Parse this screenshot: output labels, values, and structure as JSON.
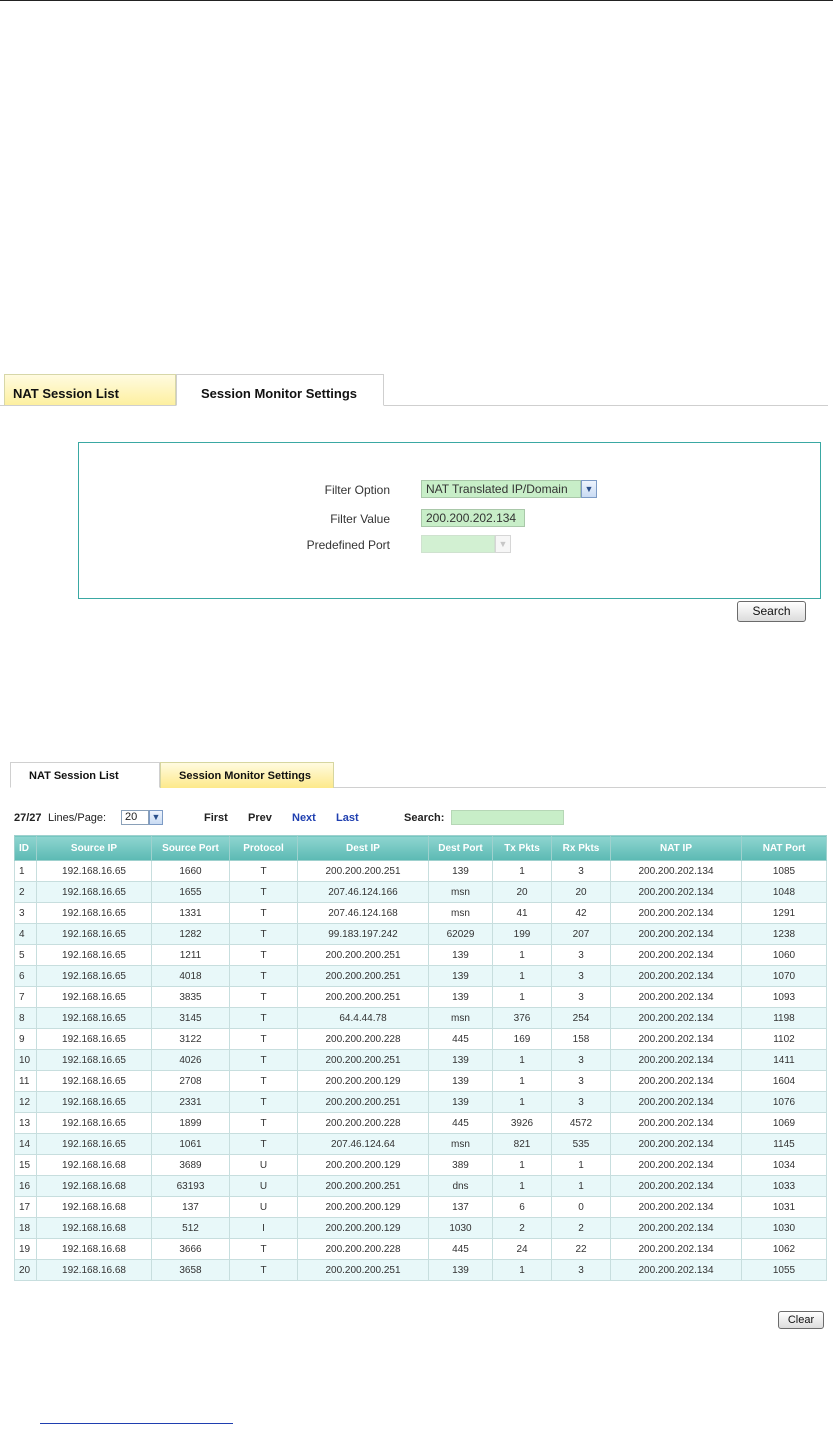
{
  "settings": {
    "tabs": [
      {
        "label": "NAT Session List",
        "active": false
      },
      {
        "label": "Session Monitor Settings",
        "active": true
      }
    ],
    "filter_option": {
      "label": "Filter Option",
      "value": "NAT Translated IP/Domain"
    },
    "filter_value": {
      "label": "Filter Value",
      "value": "200.200.202.134"
    },
    "predefined_port": {
      "label": "Predefined Port",
      "value": ""
    },
    "search_label": "Search"
  },
  "session_list": {
    "tabs": [
      {
        "label": "NAT Session List",
        "active": true
      },
      {
        "label": "Session Monitor Settings",
        "active": false
      }
    ],
    "count": "27/27",
    "lines_per_page_label": "Lines/Page:",
    "lines_per_page_value": "20",
    "first_label": "First",
    "prev_label": "Prev",
    "next_label": "Next",
    "last_label": "Last",
    "search_label": "Search:",
    "search_value": "",
    "clear_label": "Clear",
    "columns": [
      "ID",
      "Source IP",
      "Source Port",
      "Protocol",
      "Dest IP",
      "Dest Port",
      "Tx Pkts",
      "Rx Pkts",
      "NAT IP",
      "NAT Port"
    ],
    "rows": [
      [
        "1",
        "192.168.16.65",
        "1660",
        "T",
        "200.200.200.251",
        "139",
        "1",
        "3",
        "200.200.202.134",
        "1085"
      ],
      [
        "2",
        "192.168.16.65",
        "1655",
        "T",
        "207.46.124.166",
        "msn",
        "20",
        "20",
        "200.200.202.134",
        "1048"
      ],
      [
        "3",
        "192.168.16.65",
        "1331",
        "T",
        "207.46.124.168",
        "msn",
        "41",
        "42",
        "200.200.202.134",
        "1291"
      ],
      [
        "4",
        "192.168.16.65",
        "1282",
        "T",
        "99.183.197.242",
        "62029",
        "199",
        "207",
        "200.200.202.134",
        "1238"
      ],
      [
        "5",
        "192.168.16.65",
        "1211",
        "T",
        "200.200.200.251",
        "139",
        "1",
        "3",
        "200.200.202.134",
        "1060"
      ],
      [
        "6",
        "192.168.16.65",
        "4018",
        "T",
        "200.200.200.251",
        "139",
        "1",
        "3",
        "200.200.202.134",
        "1070"
      ],
      [
        "7",
        "192.168.16.65",
        "3835",
        "T",
        "200.200.200.251",
        "139",
        "1",
        "3",
        "200.200.202.134",
        "1093"
      ],
      [
        "8",
        "192.168.16.65",
        "3145",
        "T",
        "64.4.44.78",
        "msn",
        "376",
        "254",
        "200.200.202.134",
        "1198"
      ],
      [
        "9",
        "192.168.16.65",
        "3122",
        "T",
        "200.200.200.228",
        "445",
        "169",
        "158",
        "200.200.202.134",
        "1102"
      ],
      [
        "10",
        "192.168.16.65",
        "4026",
        "T",
        "200.200.200.251",
        "139",
        "1",
        "3",
        "200.200.202.134",
        "1411"
      ],
      [
        "11",
        "192.168.16.65",
        "2708",
        "T",
        "200.200.200.129",
        "139",
        "1",
        "3",
        "200.200.202.134",
        "1604"
      ],
      [
        "12",
        "192.168.16.65",
        "2331",
        "T",
        "200.200.200.251",
        "139",
        "1",
        "3",
        "200.200.202.134",
        "1076"
      ],
      [
        "13",
        "192.168.16.65",
        "1899",
        "T",
        "200.200.200.228",
        "445",
        "3926",
        "4572",
        "200.200.202.134",
        "1069"
      ],
      [
        "14",
        "192.168.16.65",
        "1061",
        "T",
        "207.46.124.64",
        "msn",
        "821",
        "535",
        "200.200.202.134",
        "1145"
      ],
      [
        "15",
        "192.168.16.68",
        "3689",
        "U",
        "200.200.200.129",
        "389",
        "1",
        "1",
        "200.200.202.134",
        "1034"
      ],
      [
        "16",
        "192.168.16.68",
        "63193",
        "U",
        "200.200.200.251",
        "dns",
        "1",
        "1",
        "200.200.202.134",
        "1033"
      ],
      [
        "17",
        "192.168.16.68",
        "137",
        "U",
        "200.200.200.129",
        "137",
        "6",
        "0",
        "200.200.202.134",
        "1031"
      ],
      [
        "18",
        "192.168.16.68",
        "512",
        "I",
        "200.200.200.129",
        "1030",
        "2",
        "2",
        "200.200.202.134",
        "1030"
      ],
      [
        "19",
        "192.168.16.68",
        "3666",
        "T",
        "200.200.200.228",
        "445",
        "24",
        "22",
        "200.200.202.134",
        "1062"
      ],
      [
        "20",
        "192.168.16.68",
        "3658",
        "T",
        "200.200.200.251",
        "139",
        "1",
        "3",
        "200.200.202.134",
        "1055"
      ]
    ]
  }
}
